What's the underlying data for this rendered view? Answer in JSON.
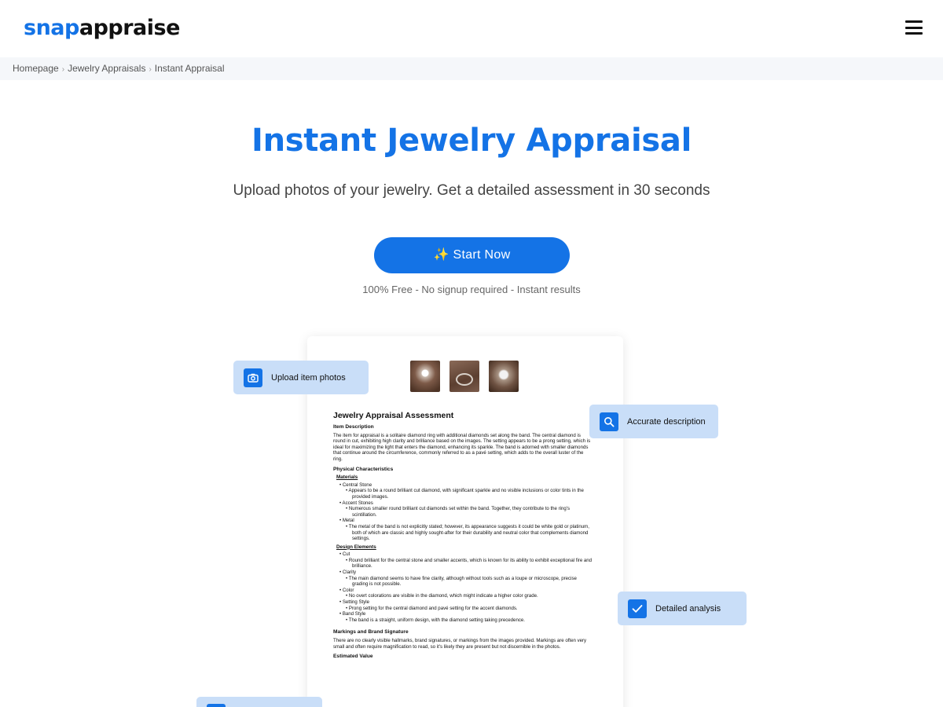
{
  "header": {
    "logo_snap": "snap",
    "logo_appraise": "appraise",
    "menu_icon": "hamburger-menu-icon"
  },
  "breadcrumb": {
    "items": [
      "Homepage",
      "Jewelry Appraisals",
      "Instant Appraisal"
    ],
    "separator": "›"
  },
  "hero": {
    "title": "Instant Jewelry Appraisal",
    "subtitle": "Upload photos of your jewelry. Get a detailed assessment in 30 seconds",
    "cta_label": "✨ Start Now",
    "cta_note": "100% Free - No signup required - Instant results"
  },
  "features": {
    "upload": {
      "label": "Upload item photos",
      "icon": "camera-icon"
    },
    "description": {
      "label": "Accurate description",
      "icon": "search-icon"
    },
    "analysis": {
      "label": "Detailed analysis",
      "icon": "checkmark-icon"
    }
  },
  "document": {
    "title": "Jewelry Appraisal Assessment",
    "item_description_heading": "Item Description",
    "item_description_text": "The item for appraisal is a solitaire diamond ring with additional diamonds set along the band. The central diamond is round in cut, exhibiting high clarity and brilliance based on the images. The setting appears to be a prong setting, which is ideal for maximizing the light that enters the diamond, enhancing its sparkle. The band is adorned with smaller diamonds that continue around the circumference, commonly referred to as a pavé setting, which adds to the overall luster of the ring.",
    "physical_heading": "Physical Characteristics",
    "materials_heading": "Materials",
    "central_stone_label": "Central Stone",
    "central_stone_text": "Appears to be a round brilliant cut diamond, with significant sparkle and no visible inclusions or color tints in the provided images.",
    "accent_stones_label": "Accent Stones",
    "accent_stones_text": "Numerous smaller round brilliant cut diamonds set within the band. Together, they contribute to the ring's scintillation.",
    "metal_label": "Metal",
    "metal_text": "The metal of the band is not explicitly stated; however, its appearance suggests it could be white gold or platinum, both of which are classic and highly sought-after for their durability and neutral color that complements diamond settings.",
    "design_heading": "Design Elements",
    "cut_label": "Cut",
    "cut_text": "Round brilliant for the central stone and smaller accents, which is known for its ability to exhibit exceptional fire and brilliance.",
    "clarity_label": "Clarity",
    "clarity_text": "The main diamond seems to have fine clarity, although without tools such as a loupe or microscope, precise grading is not possible.",
    "color_label": "Color",
    "color_text": "No overt colorations are visible in the diamond, which might indicate a higher color grade.",
    "setting_label": "Setting Style",
    "setting_text": "Prong setting for the central diamond and pavé setting for the accent diamonds.",
    "band_label": "Band Style",
    "band_text": "The band is a straight, uniform design, with the diamond setting taking precedence.",
    "markings_heading": "Markings and Brand Signature",
    "markings_text": "There are no clearly visible hallmarks, brand signatures, or markings from the images provided. Markings are often very small and often require magnification to read, so it's likely they are present but not discernible in the photos.",
    "estimated_heading": "Estimated Value"
  },
  "colors": {
    "brand_blue": "#1473e6",
    "chip_bg": "#c9def8",
    "breadcrumb_bg": "#f5f7fa"
  }
}
